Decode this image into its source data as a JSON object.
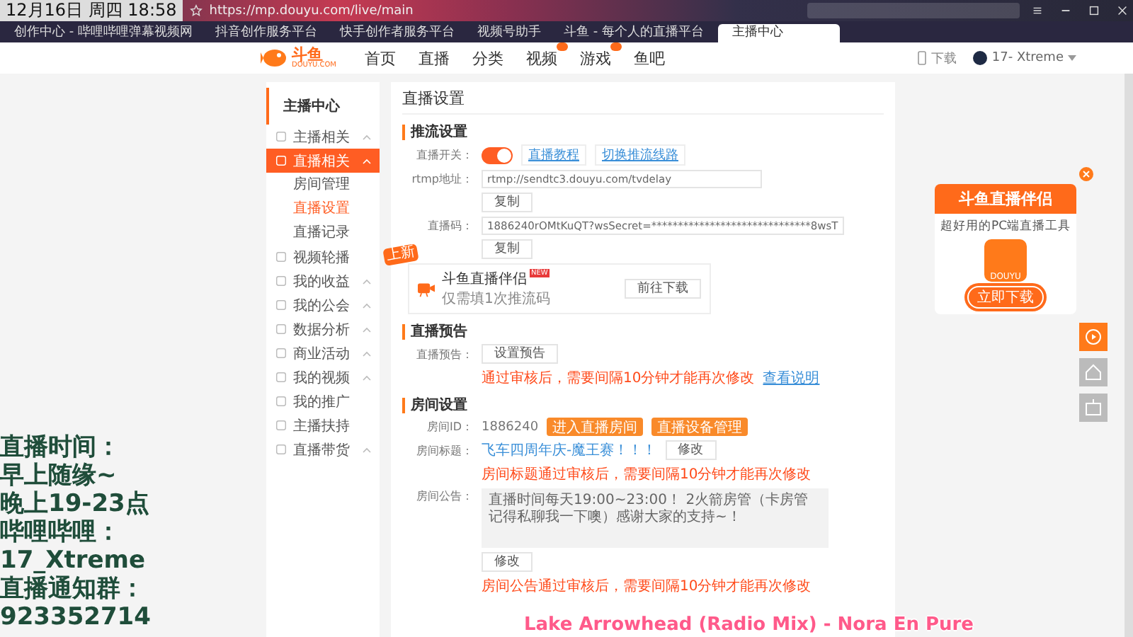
{
  "overlay_clock": "12月16日 周四 18:58",
  "address_bar": {
    "url": "https://mp.douyu.com/live/main"
  },
  "tabs": [
    {
      "label": "创作中心 - 哔哩哔哩弹幕视频网",
      "selected": false
    },
    {
      "label": "抖音创作服务平台",
      "selected": false
    },
    {
      "label": "快手创作者服务平台",
      "selected": false
    },
    {
      "label": "视频号助手",
      "selected": false
    },
    {
      "label": "斗鱼 - 每个人的直播平台",
      "selected": false
    },
    {
      "label": "主播中心",
      "selected": true
    }
  ],
  "site_header": {
    "logo": {
      "name": "斗鱼",
      "sub": "DOUYU.COM"
    },
    "nav": [
      {
        "label": "首页",
        "badge": false
      },
      {
        "label": "直播",
        "badge": false
      },
      {
        "label": "分类",
        "badge": false
      },
      {
        "label": "视频",
        "badge": true
      },
      {
        "label": "游戏",
        "badge": true
      },
      {
        "label": "鱼吧",
        "badge": false
      }
    ],
    "download": "下载",
    "user": "17- Xtreme"
  },
  "sidebar": {
    "title": "主播中心",
    "items": [
      {
        "label": "主播相关",
        "selected": false,
        "collapsible": true
      },
      {
        "label": "直播相关",
        "selected": true,
        "collapsible": true,
        "children": [
          {
            "label": "房间管理",
            "selected": false
          },
          {
            "label": "直播设置",
            "selected": true
          },
          {
            "label": "直播记录",
            "selected": false
          }
        ]
      },
      {
        "label": "视频轮播",
        "selected": false,
        "collapsible": false,
        "badge": "上新"
      },
      {
        "label": "我的收益",
        "selected": false,
        "collapsible": true
      },
      {
        "label": "我的公会",
        "selected": false,
        "collapsible": true
      },
      {
        "label": "数据分析",
        "selected": false,
        "collapsible": true
      },
      {
        "label": "商业活动",
        "selected": false,
        "collapsible": true
      },
      {
        "label": "我的视频",
        "selected": false,
        "collapsible": true
      },
      {
        "label": "我的推广",
        "selected": false,
        "collapsible": false
      },
      {
        "label": "主播扶持",
        "selected": false,
        "collapsible": false
      },
      {
        "label": "直播带货",
        "selected": false,
        "collapsible": true
      }
    ]
  },
  "main": {
    "title": "直播设置",
    "push": {
      "heading": "推流设置",
      "switch_label": "直播开关：",
      "switch_on": true,
      "links": [
        "直播教程",
        "切换推流线路"
      ],
      "rtmp_label": "rtmp地址：",
      "rtmp_value": "rtmp://sendtc3.douyu.com/tvdelay",
      "copy1": "复制",
      "code_label": "直播码：",
      "code_value": "1886240rOMtKuQT?wsSecret=******************************8wsT",
      "copy2": "复制",
      "promo": {
        "title": "斗鱼直播伴侣",
        "tag": "NEW",
        "desc": "仅需填1次推流码",
        "button": "前往下载"
      }
    },
    "preview": {
      "heading": "直播预告",
      "label": "直播预告：",
      "button": "设置预告",
      "note": "通过审核后，需要间隔10分钟才能再次修改",
      "link": "查看说明"
    },
    "room": {
      "heading": "房间设置",
      "id_label": "房间ID：",
      "id": "1886240",
      "buttons": [
        "进入直播房间",
        "直播设备管理"
      ],
      "title_label": "房间标题：",
      "title": "飞车四周年庆-魔王赛！！！",
      "title_button": "修改",
      "title_note": "房间标题通过审核后，需要间隔10分钟才能再次修改",
      "notice_label": "房间公告：",
      "notice": "直播时间每天19:00~23:00！ 2火箭房管（卡房管记得私聊我一下噢）感谢大家的支持~！",
      "notice_button": "修改",
      "notice_note": "房间公告通过审核后，需要间隔10分钟才能再次修改"
    }
  },
  "float_card": {
    "title": "斗鱼直播伴侣",
    "desc": "超好用的PC端直播工具",
    "app": "DOUYU",
    "button": "立即下载"
  },
  "stream_overlay": [
    "直播时间：",
    "早上随缘~",
    "晚上19-23点",
    "哔哩哔哩：",
    "17_Xtreme",
    "直播通知群：",
    "923352714"
  ],
  "now_playing": "Lake Arrowhead (Radio Mix) - Nora En Pure"
}
